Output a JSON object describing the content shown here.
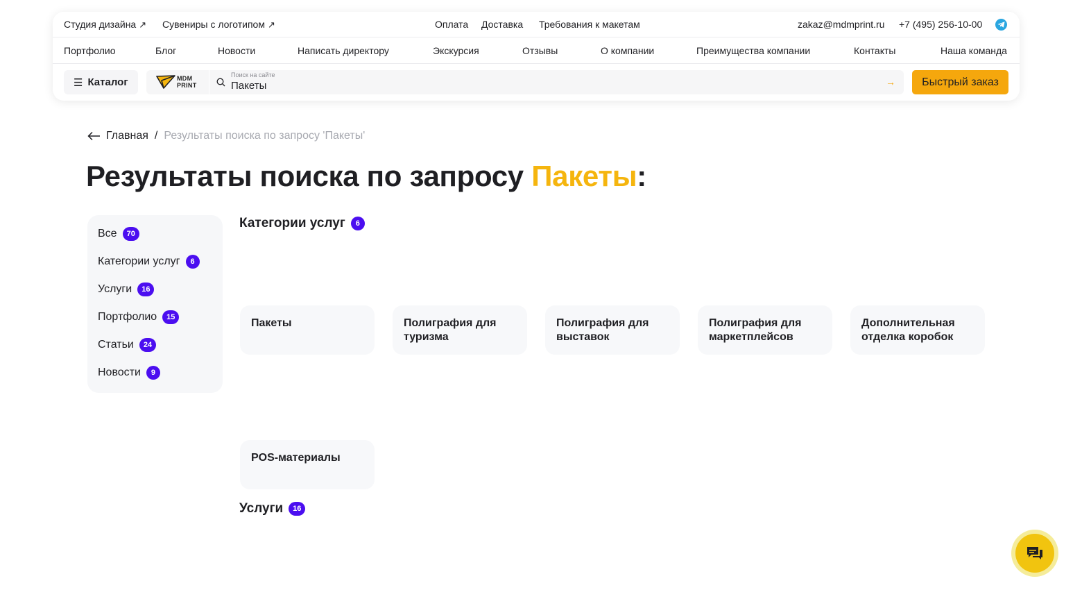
{
  "topbar": {
    "left_links": [
      "Студия дизайна",
      "Сувениры с логотипом"
    ],
    "center_links": [
      "Оплата",
      "Доставка",
      "Требования к макетам"
    ],
    "email": "zakaz@mdmprint.ru",
    "phone": "+7 (495) 256-10-00"
  },
  "nav": [
    "Портфолио",
    "Блог",
    "Новости",
    "Написать директору",
    "Экскурсия",
    "Отзывы",
    "О компании",
    "Преимущества компании",
    "Контакты",
    "Наша команда"
  ],
  "toolbar": {
    "catalog_label": "Каталог",
    "logo_text_line1": "MDM",
    "logo_text_line2": "PRINT",
    "search_caption": "Поиск на сайте",
    "search_value": "Пакеты",
    "quick_order_label": "Быстрый заказ"
  },
  "breadcrumb": {
    "home": "Главная",
    "separator": "/",
    "current": "Результаты поиска по запросу 'Пакеты'"
  },
  "title": {
    "prefix": "Результаты поиска по запросу ",
    "query": "Пакеты",
    "suffix": ":"
  },
  "filters": [
    {
      "label": "Все",
      "count": "70"
    },
    {
      "label": "Категории услуг",
      "count": "6"
    },
    {
      "label": "Услуги",
      "count": "16"
    },
    {
      "label": "Портфолио",
      "count": "15"
    },
    {
      "label": "Статьи",
      "count": "24"
    },
    {
      "label": "Новости",
      "count": "9"
    }
  ],
  "sections": {
    "categories": {
      "title": "Категории услуг",
      "count": "6"
    },
    "services": {
      "title": "Услуги",
      "count": "16"
    }
  },
  "category_cards": [
    {
      "line1": "Пакеты",
      "line2": ""
    },
    {
      "line1": "Полиграфия для",
      "line2": "туризма"
    },
    {
      "line1": "Полиграфия для",
      "line2": "выставок"
    },
    {
      "line1": "Полиграфия для",
      "line2": "маркетплейсов"
    },
    {
      "line1": "Дополнительная",
      "line2": "отделка коробок"
    },
    {
      "line1": "POS-материалы",
      "line2": ""
    }
  ],
  "colors": {
    "accent": "#f5a70d",
    "title_highlight": "#f5b50e",
    "badge": "#4b0ef0",
    "chat": "#f1c40f",
    "telegram": "#2aa6e0"
  },
  "icons": [
    "arrow-up-right-icon",
    "telegram-icon",
    "menu-icon",
    "search-icon",
    "arrow-right-icon",
    "arrow-left-icon",
    "chat-icon",
    "logo-plane-icon"
  ]
}
